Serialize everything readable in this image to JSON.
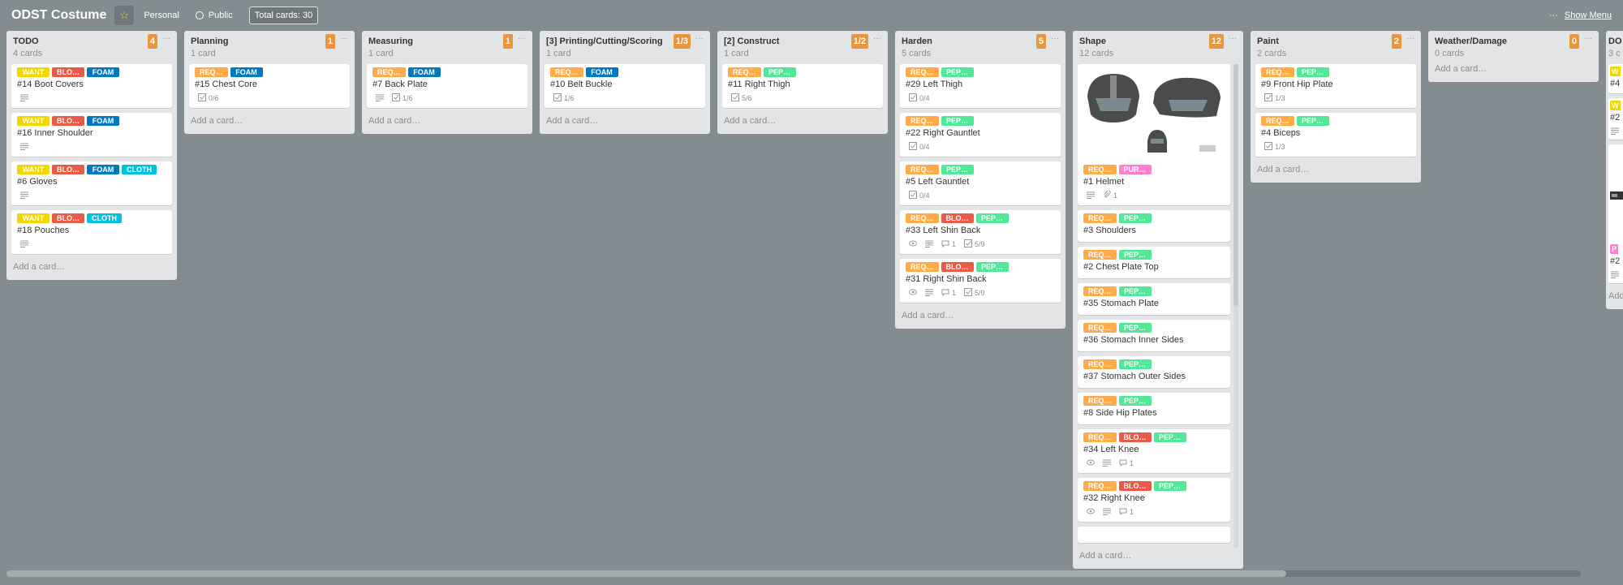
{
  "header": {
    "title": "ODST Costume",
    "star_icon": "star-icon",
    "personal": "Personal",
    "public": "Public",
    "total": "Total cards: 30",
    "menu_dots": "···",
    "show_menu": "Show Menu"
  },
  "label_colors": {
    "yellow": "#f2d600",
    "red": "#eb5a46",
    "blue": "#0079bf",
    "sky": "#00c2e0",
    "orange": "#ffab4a",
    "green": "#51e898",
    "pink": "#ff80ce"
  },
  "add_card": "Add a card…",
  "lists": [
    {
      "title": "TODO",
      "count": "4 cards",
      "badge": "4",
      "cards": [
        {
          "labels": [
            [
              "WANT",
              "yellow"
            ],
            [
              "BLO…",
              "red"
            ],
            [
              "FOAM",
              "blue"
            ]
          ],
          "title": "#14 Boot Covers",
          "badges": {
            "desc": true
          }
        },
        {
          "labels": [
            [
              "WANT",
              "yellow"
            ],
            [
              "BLO…",
              "red"
            ],
            [
              "FOAM",
              "blue"
            ]
          ],
          "title": "#16 Inner Shoulder",
          "badges": {
            "desc": true
          }
        },
        {
          "labels": [
            [
              "WANT",
              "yellow"
            ],
            [
              "BLO…",
              "red"
            ],
            [
              "FOAM",
              "blue"
            ],
            [
              "CLOTH",
              "sky"
            ]
          ],
          "title": "#6 Gloves",
          "badges": {
            "desc": true
          }
        },
        {
          "labels": [
            [
              "WANT",
              "yellow"
            ],
            [
              "BLO…",
              "red"
            ],
            [
              "CLOTH",
              "sky"
            ]
          ],
          "title": "#18 Pouches",
          "badges": {
            "desc": true
          }
        }
      ]
    },
    {
      "title": "Planning",
      "count": "1 card",
      "badge": "1",
      "cards": [
        {
          "labels": [
            [
              "REQ…",
              "orange"
            ],
            [
              "FOAM",
              "blue"
            ]
          ],
          "title": "#15 Chest Core",
          "badges": {
            "checklist": "0/6"
          }
        }
      ]
    },
    {
      "title": "Measuring",
      "count": "1 card",
      "badge": "1",
      "cards": [
        {
          "labels": [
            [
              "REQ…",
              "orange"
            ],
            [
              "FOAM",
              "blue"
            ]
          ],
          "title": "#7 Back Plate",
          "badges": {
            "desc": true,
            "checklist": "1/6"
          }
        }
      ]
    },
    {
      "title": "[3] Printing/Cutting/Scoring",
      "count": "1 card",
      "badge": "1/3",
      "cards": [
        {
          "labels": [
            [
              "REQ…",
              "orange"
            ],
            [
              "FOAM",
              "blue"
            ]
          ],
          "title": "#10 Belt Buckle",
          "badges": {
            "checklist": "1/6"
          }
        }
      ]
    },
    {
      "title": "[2] Construct",
      "count": "1 card",
      "badge": "1/2",
      "cards": [
        {
          "labels": [
            [
              "REQ…",
              "orange"
            ],
            [
              "PEP…",
              "green"
            ]
          ],
          "title": "#11 Right Thigh",
          "badges": {
            "checklist": "5/6"
          }
        }
      ]
    },
    {
      "title": "Harden",
      "count": "5 cards",
      "badge": "5",
      "cards": [
        {
          "labels": [
            [
              "REQ…",
              "orange"
            ],
            [
              "PEP…",
              "green"
            ]
          ],
          "title": "#29 Left Thigh",
          "badges": {
            "checklist": "0/4"
          }
        },
        {
          "labels": [
            [
              "REQ…",
              "orange"
            ],
            [
              "PEP…",
              "green"
            ]
          ],
          "title": "#22 Right Gauntlet",
          "badges": {
            "checklist": "0/4"
          }
        },
        {
          "labels": [
            [
              "REQ…",
              "orange"
            ],
            [
              "PEP…",
              "green"
            ]
          ],
          "title": "#5 Left Gauntlet",
          "badges": {
            "checklist": "0/4"
          }
        },
        {
          "labels": [
            [
              "REQ…",
              "orange"
            ],
            [
              "BLO…",
              "red"
            ],
            [
              "PEP…",
              "green"
            ]
          ],
          "title": "#33 Left Shin Back",
          "badges": {
            "watch": true,
            "desc": true,
            "comments": "1",
            "checklist": "5/9"
          }
        },
        {
          "labels": [
            [
              "REQ…",
              "orange"
            ],
            [
              "BLO…",
              "red"
            ],
            [
              "PEP…",
              "green"
            ]
          ],
          "title": "#31 Right Shin Back",
          "badges": {
            "watch": true,
            "desc": true,
            "comments": "1",
            "checklist": "5/9"
          }
        }
      ]
    },
    {
      "title": "Shape",
      "count": "12 cards",
      "badge": "12",
      "scroll": true,
      "cards": [
        {
          "cover": "helmet-image",
          "labels": [
            [
              "REQ…",
              "orange"
            ],
            [
              "PUR…",
              "pink"
            ]
          ],
          "title": "#1 Helmet",
          "badges": {
            "desc": true,
            "attachments": "1"
          }
        },
        {
          "labels": [
            [
              "REQ…",
              "orange"
            ],
            [
              "PEP…",
              "green"
            ]
          ],
          "title": "#3 Shoulders",
          "badges": {}
        },
        {
          "labels": [
            [
              "REQ…",
              "orange"
            ],
            [
              "PEP…",
              "green"
            ]
          ],
          "title": "#2 Chest Plate Top",
          "badges": {}
        },
        {
          "labels": [
            [
              "REQ…",
              "orange"
            ],
            [
              "PEP…",
              "green"
            ]
          ],
          "title": "#35 Stomach Plate",
          "badges": {}
        },
        {
          "labels": [
            [
              "REQ…",
              "orange"
            ],
            [
              "PEP…",
              "green"
            ]
          ],
          "title": "#36 Stomach Inner Sides",
          "badges": {}
        },
        {
          "labels": [
            [
              "REQ…",
              "orange"
            ],
            [
              "PEP…",
              "green"
            ]
          ],
          "title": "#37 Stomach Outer Sides",
          "badges": {}
        },
        {
          "labels": [
            [
              "REQ…",
              "orange"
            ],
            [
              "PEP…",
              "green"
            ]
          ],
          "title": "#8 Side Hip Plates",
          "badges": {}
        },
        {
          "labels": [
            [
              "REQ…",
              "orange"
            ],
            [
              "BLO…",
              "red"
            ],
            [
              "PEP…",
              "green"
            ]
          ],
          "title": "#34 Left Knee",
          "badges": {
            "watch": true,
            "desc": true,
            "comments": "1"
          }
        },
        {
          "labels": [
            [
              "REQ…",
              "orange"
            ],
            [
              "BLO…",
              "red"
            ],
            [
              "PEP…",
              "green"
            ]
          ],
          "title": "#32 Right Knee",
          "badges": {
            "watch": true,
            "desc": true,
            "comments": "1"
          }
        },
        {
          "labels": [],
          "title": "",
          "badges": {}
        }
      ]
    },
    {
      "title": "Paint",
      "count": "2 cards",
      "badge": "2",
      "cards": [
        {
          "labels": [
            [
              "REQ…",
              "orange"
            ],
            [
              "PEP…",
              "green"
            ]
          ],
          "title": "#9 Front Hip Plate",
          "badges": {
            "checklist": "1/3"
          }
        },
        {
          "labels": [
            [
              "REQ…",
              "orange"
            ],
            [
              "PEP…",
              "green"
            ]
          ],
          "title": "#4 Biceps",
          "badges": {
            "checklist": "1/3"
          }
        }
      ]
    },
    {
      "title": "Weather/Damage",
      "count": "0 cards",
      "badge": "0",
      "cards": []
    },
    {
      "title": "DO",
      "count": "3 c",
      "badge": "",
      "cards": [
        {
          "labels": [
            [
              "W",
              "yellow"
            ]
          ],
          "title": "#4",
          "badges": {}
        },
        {
          "labels": [
            [
              "W",
              "yellow"
            ]
          ],
          "title": "#2",
          "badges": {
            "desc": true
          }
        },
        {
          "cover": "dark-image",
          "labels": [
            [
              "P",
              "pink"
            ]
          ],
          "title": "#2",
          "badges": {
            "desc": true
          }
        }
      ],
      "add": "Add"
    }
  ]
}
